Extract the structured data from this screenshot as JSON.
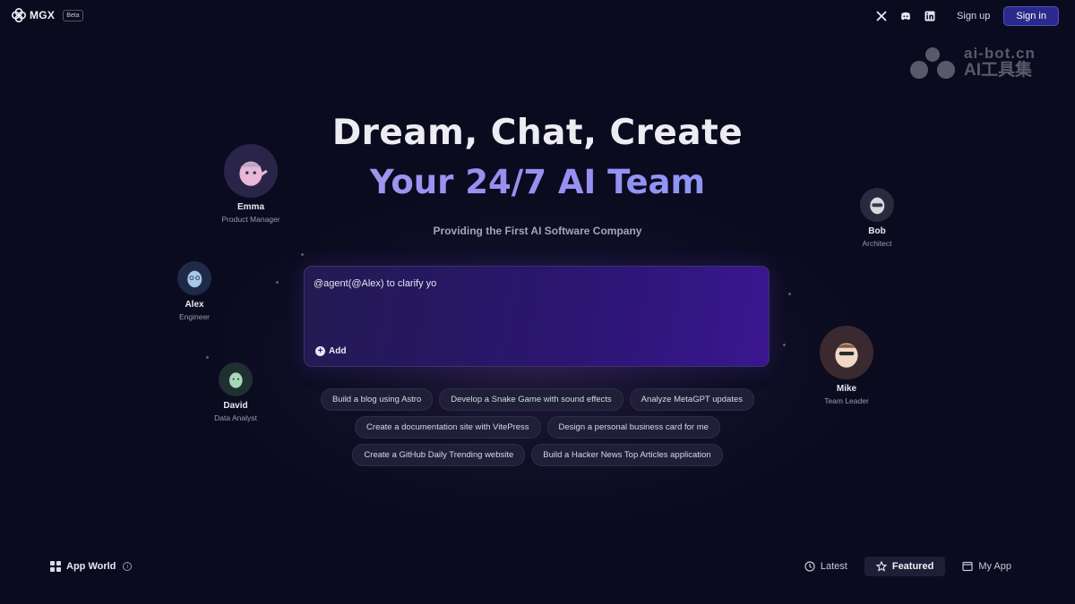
{
  "header": {
    "brand": "MGX",
    "beta": "Beta",
    "icons": [
      "x-icon",
      "discord-icon",
      "linkedin-icon"
    ],
    "signup": "Sign up",
    "signin": "Sign in"
  },
  "watermark": {
    "line1": "ai-bot.cn",
    "line2": "AI工具集"
  },
  "hero": {
    "title": "Dream, Chat, Create",
    "subtitle": "Your 24/7 AI Team",
    "tagline": "Providing the First AI Software Company"
  },
  "agents": [
    {
      "name": "Emma",
      "role": "Product Manager"
    },
    {
      "name": "Bob",
      "role": "Architect"
    },
    {
      "name": "Alex",
      "role": "Engineer"
    },
    {
      "name": "David",
      "role": "Data Analyst"
    },
    {
      "name": "Mike",
      "role": "Team Leader"
    }
  ],
  "chat": {
    "value": "@agent(@Alex) to clarify yo",
    "add_label": "Add"
  },
  "suggestions": {
    "row1": [
      "Build a blog using Astro",
      "Develop a Snake Game with sound effects",
      "Analyze MetaGPT updates"
    ],
    "row2": [
      "Create a documentation site with VitePress",
      "Design a personal business card for me"
    ],
    "row3": [
      "Create a GitHub Daily Trending website",
      "Build a Hacker News Top Articles application"
    ]
  },
  "footer": {
    "app_world": "App World",
    "tabs": [
      "Latest",
      "Featured",
      "My App"
    ],
    "active_tab": "Featured"
  },
  "colors": {
    "background": "#0b0b1f",
    "accent": "#5050c8",
    "title_gradient": [
      "#c4a6ee",
      "#7da0ff"
    ],
    "chat_gradient": [
      "#231a52",
      "#3a1690"
    ]
  }
}
